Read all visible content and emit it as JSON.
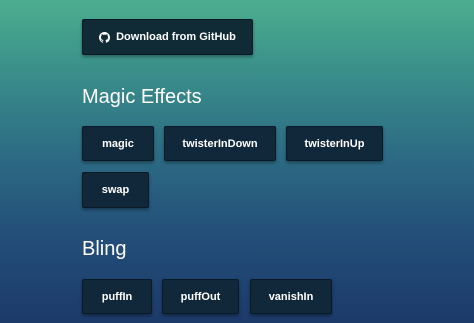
{
  "header": {
    "github_button_label": "Download from GitHub"
  },
  "sections": {
    "magic": {
      "title": "Magic Effects",
      "buttons": [
        "magic",
        "twisterInDown",
        "twisterInUp",
        "swap"
      ]
    },
    "bling": {
      "title": "Bling",
      "buttons": [
        "puffIn",
        "puffOut",
        "vanishIn"
      ]
    }
  },
  "colors": {
    "button_bg": "#11283a",
    "gradient_top": "#4cae8e",
    "gradient_bottom": "#1c3a6a"
  },
  "icons": {
    "github": "github-icon"
  }
}
